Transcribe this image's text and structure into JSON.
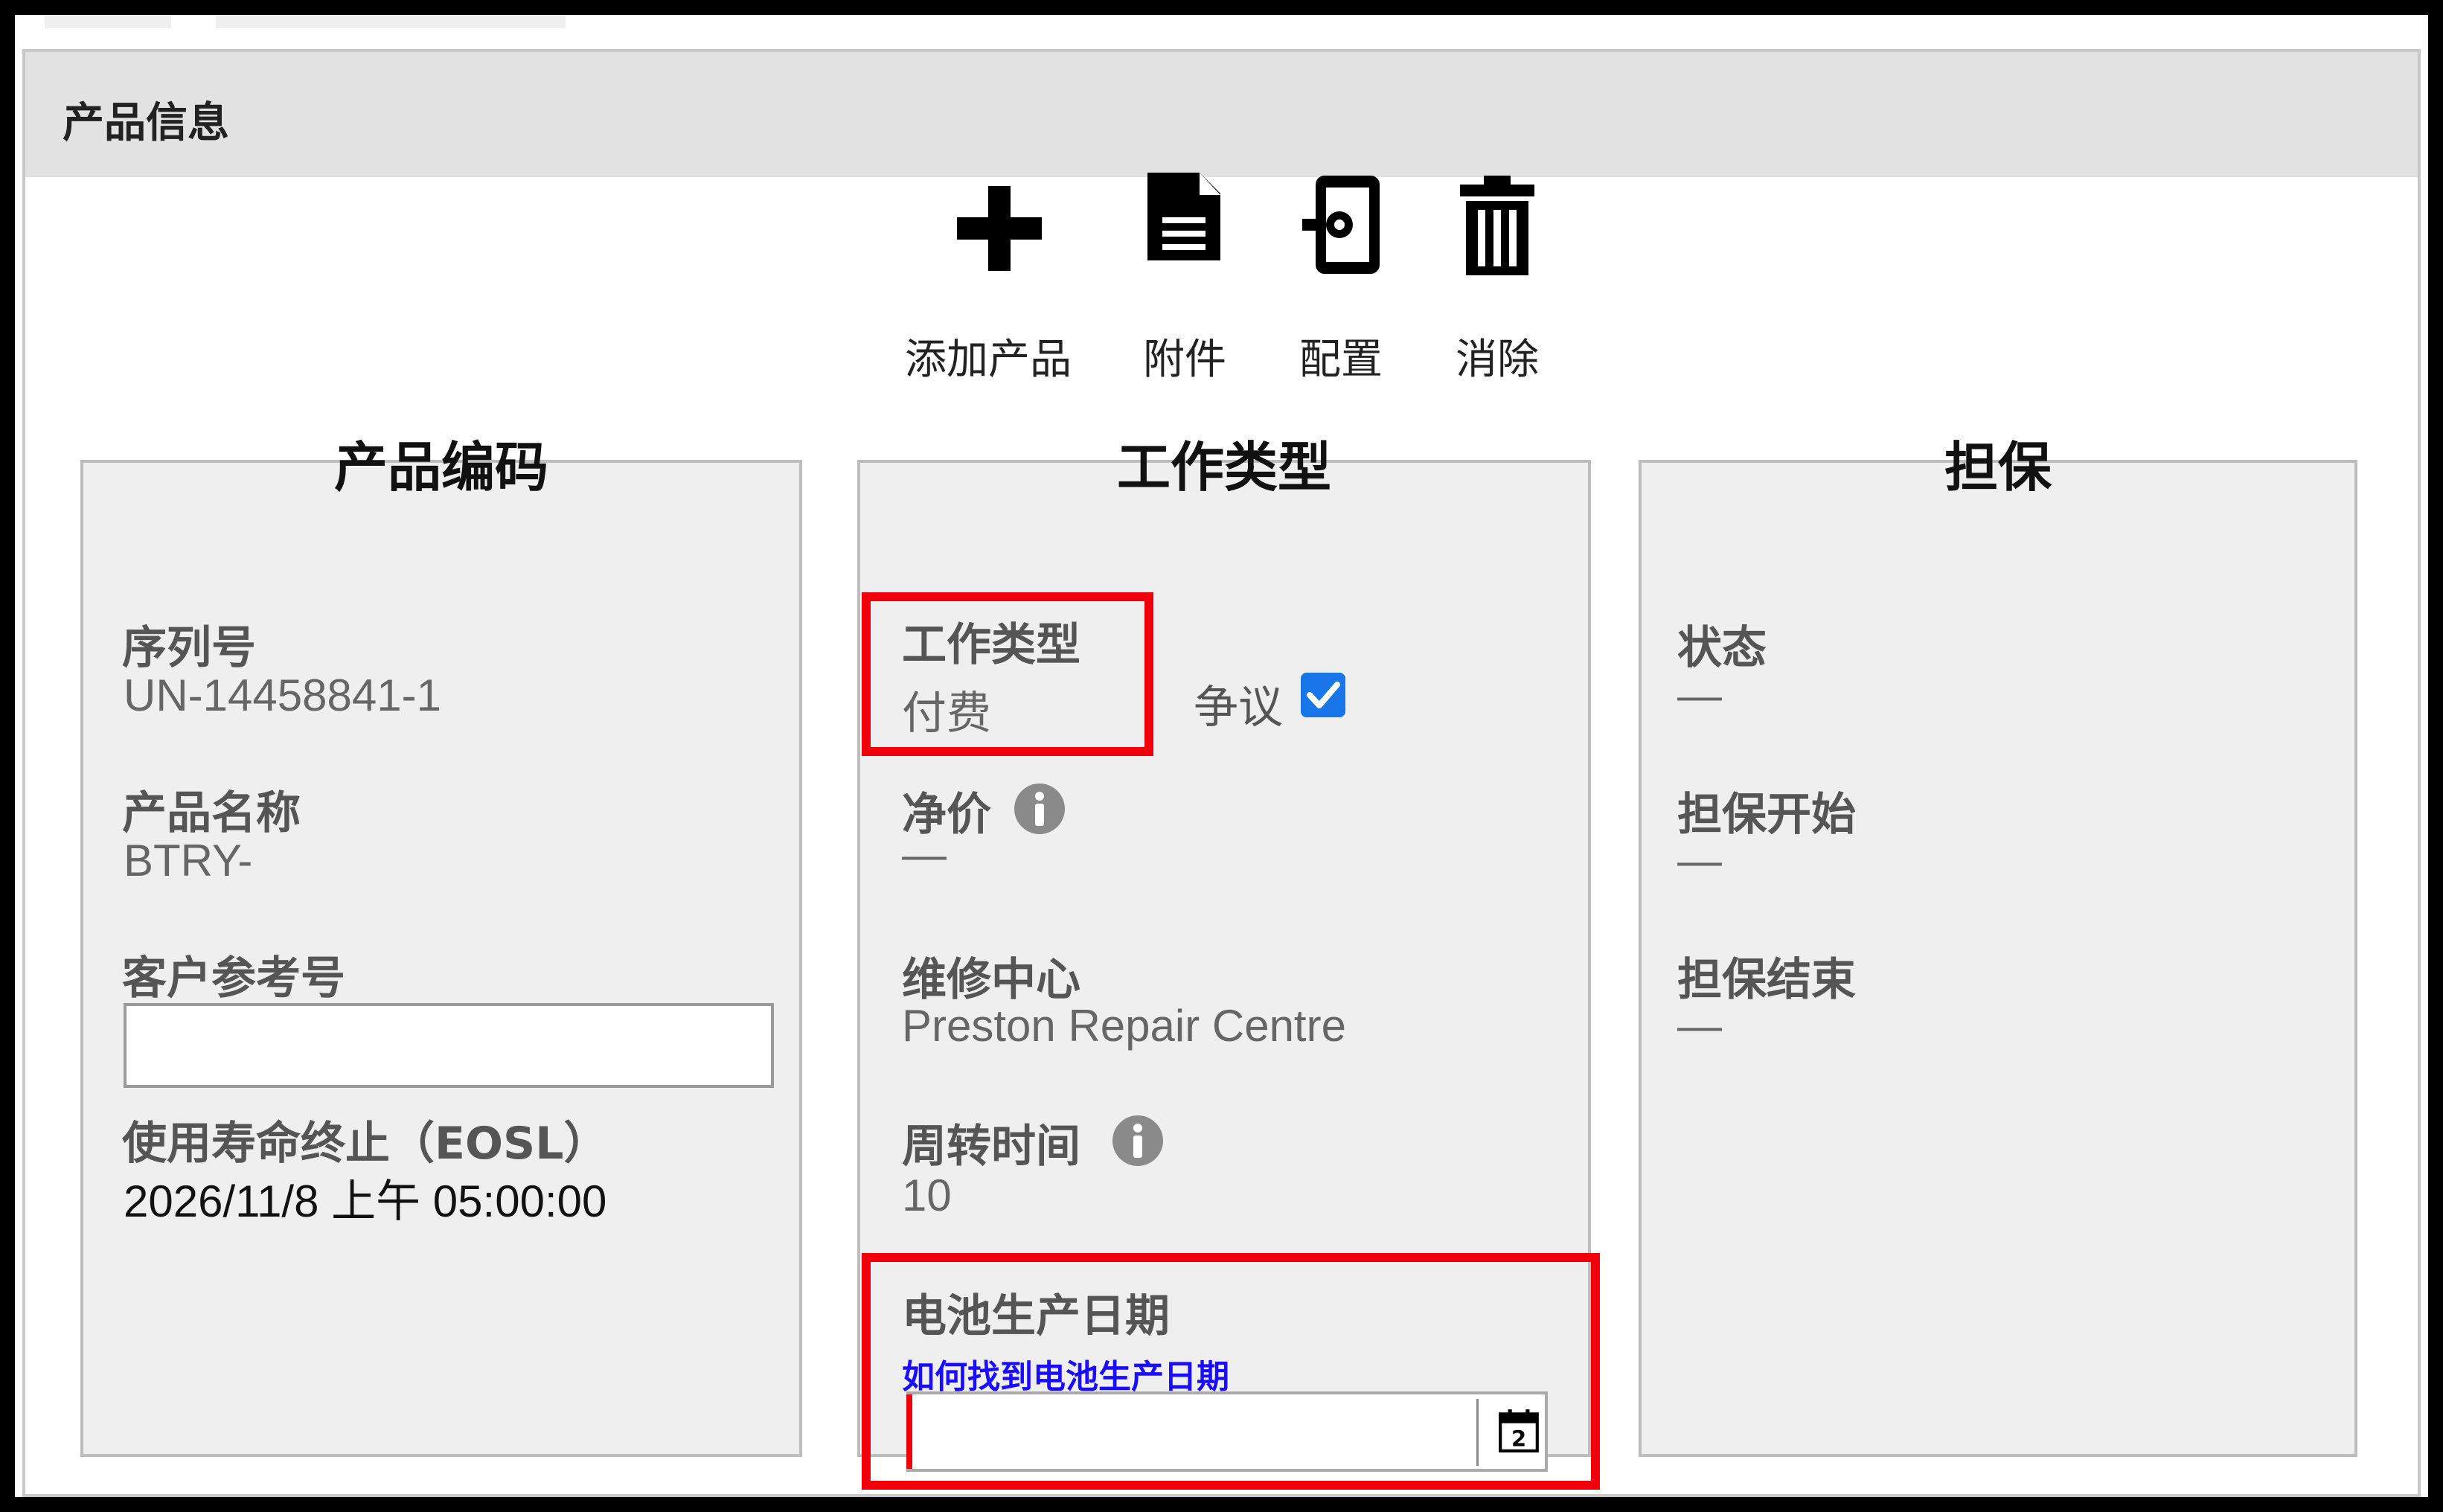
{
  "panel": {
    "title": "产品信息"
  },
  "toolbar": {
    "add_product": "添加产品",
    "attachment": "附件",
    "config": "配置",
    "clear": "消除"
  },
  "product_code": {
    "title": "产品编码",
    "serial_label": "序列号",
    "serial_value": "UN-14458841-1",
    "name_label": "产品名称",
    "name_value": "BTRY-",
    "customer_ref_label": "客户参考号",
    "customer_ref_value": "",
    "eosl_label": "使用寿命终止（EOSL）",
    "eosl_value": "2026/11/8 上午 05:00:00"
  },
  "work_type": {
    "title": "工作类型",
    "type_label": "工作类型",
    "type_value": "付费",
    "dispute_label": "争议",
    "dispute_checked": true,
    "net_price_label": "净价",
    "net_price_value": "—",
    "repair_center_label": "维修中心",
    "repair_center_value": "Preston Repair Centre",
    "turnaround_label": "周转时间",
    "turnaround_value": "10",
    "battery_date_label": "电池生产日期",
    "battery_date_link": "如何找到电池生产日期",
    "battery_date_value": "",
    "calendar_day": "2"
  },
  "warranty": {
    "title": "担保",
    "status_label": "状态",
    "status_value": "—",
    "start_label": "担保开始",
    "start_value": "—",
    "end_label": "担保结束",
    "end_value": "—"
  },
  "colors": {
    "highlight": "#f0000a",
    "link": "#1a0dff",
    "checkbox": "#1976e8"
  }
}
